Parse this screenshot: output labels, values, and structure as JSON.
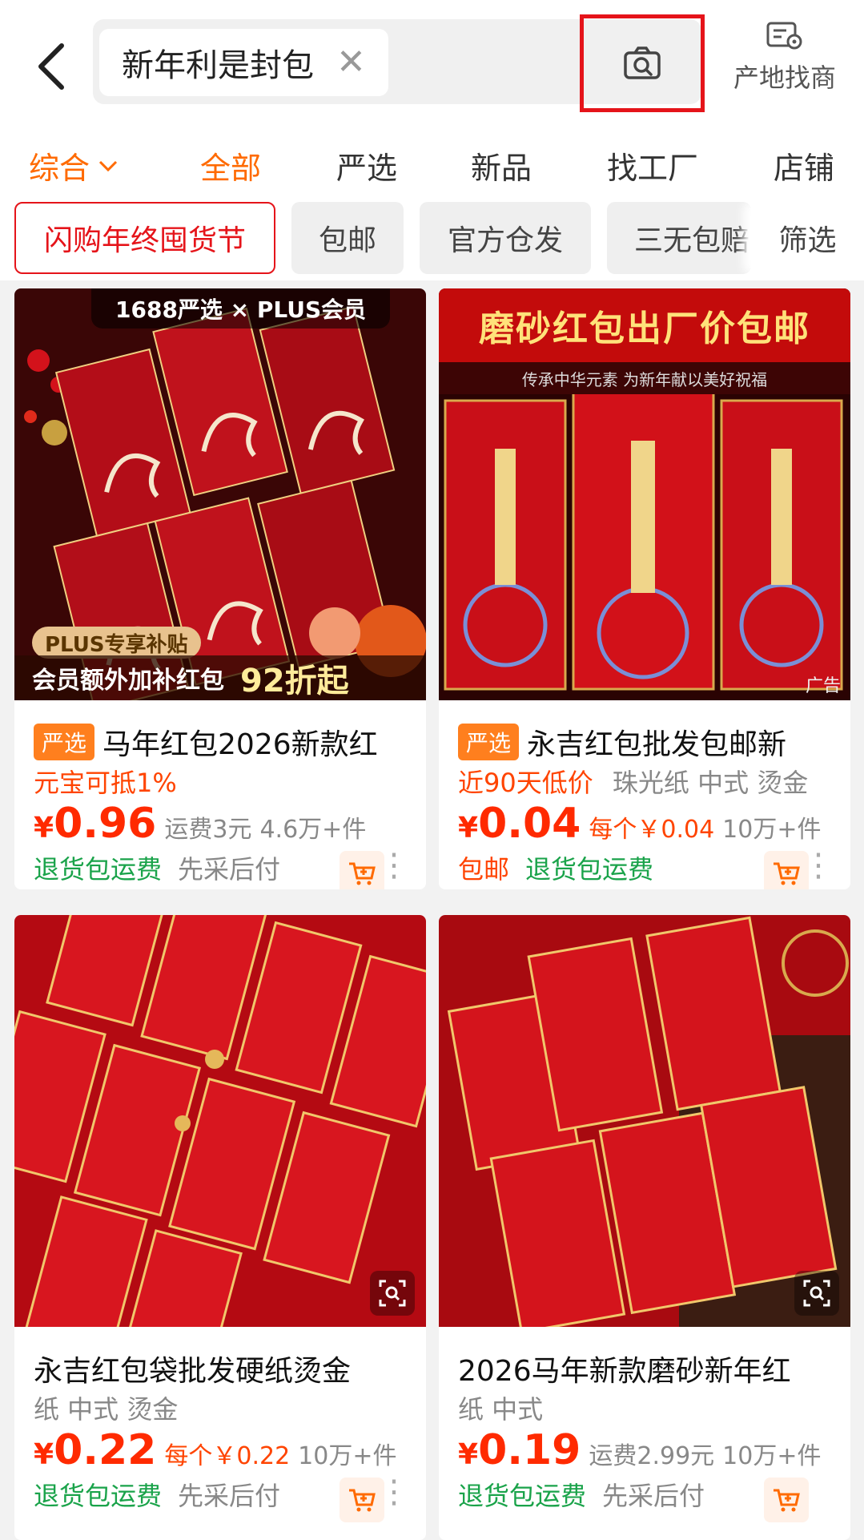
{
  "header": {
    "back_icon": "chevron-left-icon",
    "search_query": "新年利是封包",
    "clear_icon": "close-icon",
    "camera_icon": "camera-search-icon",
    "origin_label": "产地找商",
    "origin_icon": "map-pin-card-icon"
  },
  "tabs": [
    {
      "label": "综合",
      "active": true
    },
    {
      "label": "全部",
      "active": true
    },
    {
      "label": "严选"
    },
    {
      "label": "新品"
    },
    {
      "label": "找工厂"
    },
    {
      "label": "店铺"
    }
  ],
  "filters": {
    "promo": "闪购年终囤货节",
    "items": [
      "包邮",
      "官方仓发",
      "三无包赔"
    ],
    "filter_label": "筛选"
  },
  "products": [
    {
      "tag": "严选",
      "title": "马年红包2026新款红",
      "highlight": "元宝可抵1%",
      "price_currency": "¥",
      "price": "0.96",
      "shipping": "运费3元",
      "sold": "4.6万+件",
      "badges": [
        "退货包运费",
        "先采后付"
      ],
      "image": {
        "top_banner": "1688严选 × PLUS会员",
        "plus_badge": "PLUS专享补贴",
        "plus_bar": "会员额外加补红包",
        "plus_off": "92折起"
      }
    },
    {
      "tag": "严选",
      "title": "永吉红包批发包邮新",
      "highlight": "近90天低价",
      "subtitle": "珠光纸 中式 烫金",
      "price_currency": "¥",
      "price": "0.04",
      "unit_price": "每个￥0.04",
      "sold": "10万+件",
      "badges_red": "包邮",
      "badges": [
        "退货包运费"
      ],
      "image": {
        "banner": "磨砂红包出厂价包邮",
        "banner_sub": "传承中华元素 为新年献以美好祝福",
        "ad": "广告"
      }
    },
    {
      "title": "永吉红包袋批发硬纸烫金",
      "subtitle": "纸 中式 烫金",
      "price_currency": "¥",
      "price": "0.22",
      "unit_price": "每个￥0.22",
      "sold": "10万+件",
      "badges": [
        "退货包运费",
        "先采后付"
      ]
    },
    {
      "title": "2026马年新款磨砂新年红",
      "subtitle": "纸 中式",
      "price_currency": "¥",
      "price": "0.19",
      "shipping": "运费2.99元",
      "sold": "10万+件",
      "badges": [
        "退货包运费",
        "先采后付"
      ]
    }
  ],
  "colors": {
    "accent_orange": "#ff6a00",
    "price_red": "#ff2a00",
    "highlight_border": "#e5141a",
    "green": "#1aa34a"
  }
}
